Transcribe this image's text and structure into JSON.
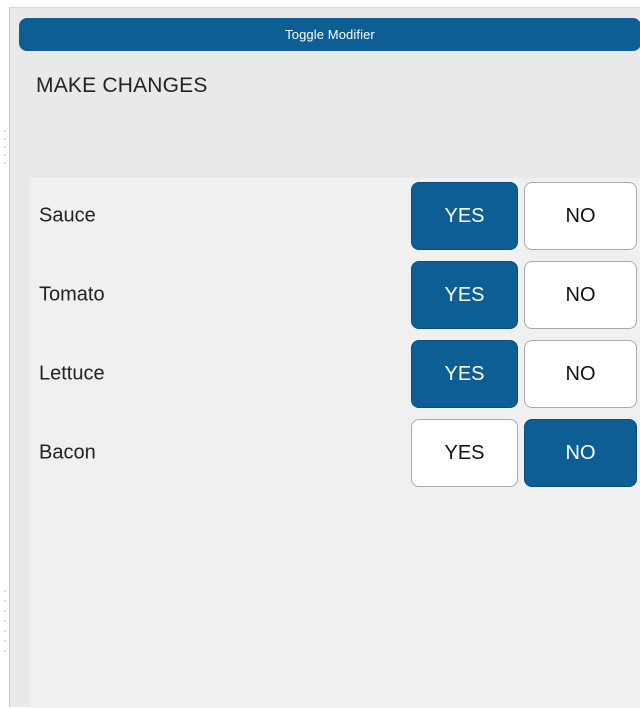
{
  "window": {
    "title": "Toggle Modifier"
  },
  "heading": "MAKE CHANGES",
  "modifiers": [
    {
      "label": "Sauce",
      "yes_label": "YES",
      "no_label": "NO",
      "selected": "YES"
    },
    {
      "label": "Tomato",
      "yes_label": "YES",
      "no_label": "NO",
      "selected": "YES"
    },
    {
      "label": "Lettuce",
      "yes_label": "YES",
      "no_label": "NO",
      "selected": "YES"
    },
    {
      "label": "Bacon",
      "yes_label": "YES",
      "no_label": "NO",
      "selected": "NO"
    }
  ],
  "colors": {
    "accent": "#0d5e94",
    "panel_bg": "#f0f0f0",
    "window_bg": "#e9e9e9"
  }
}
